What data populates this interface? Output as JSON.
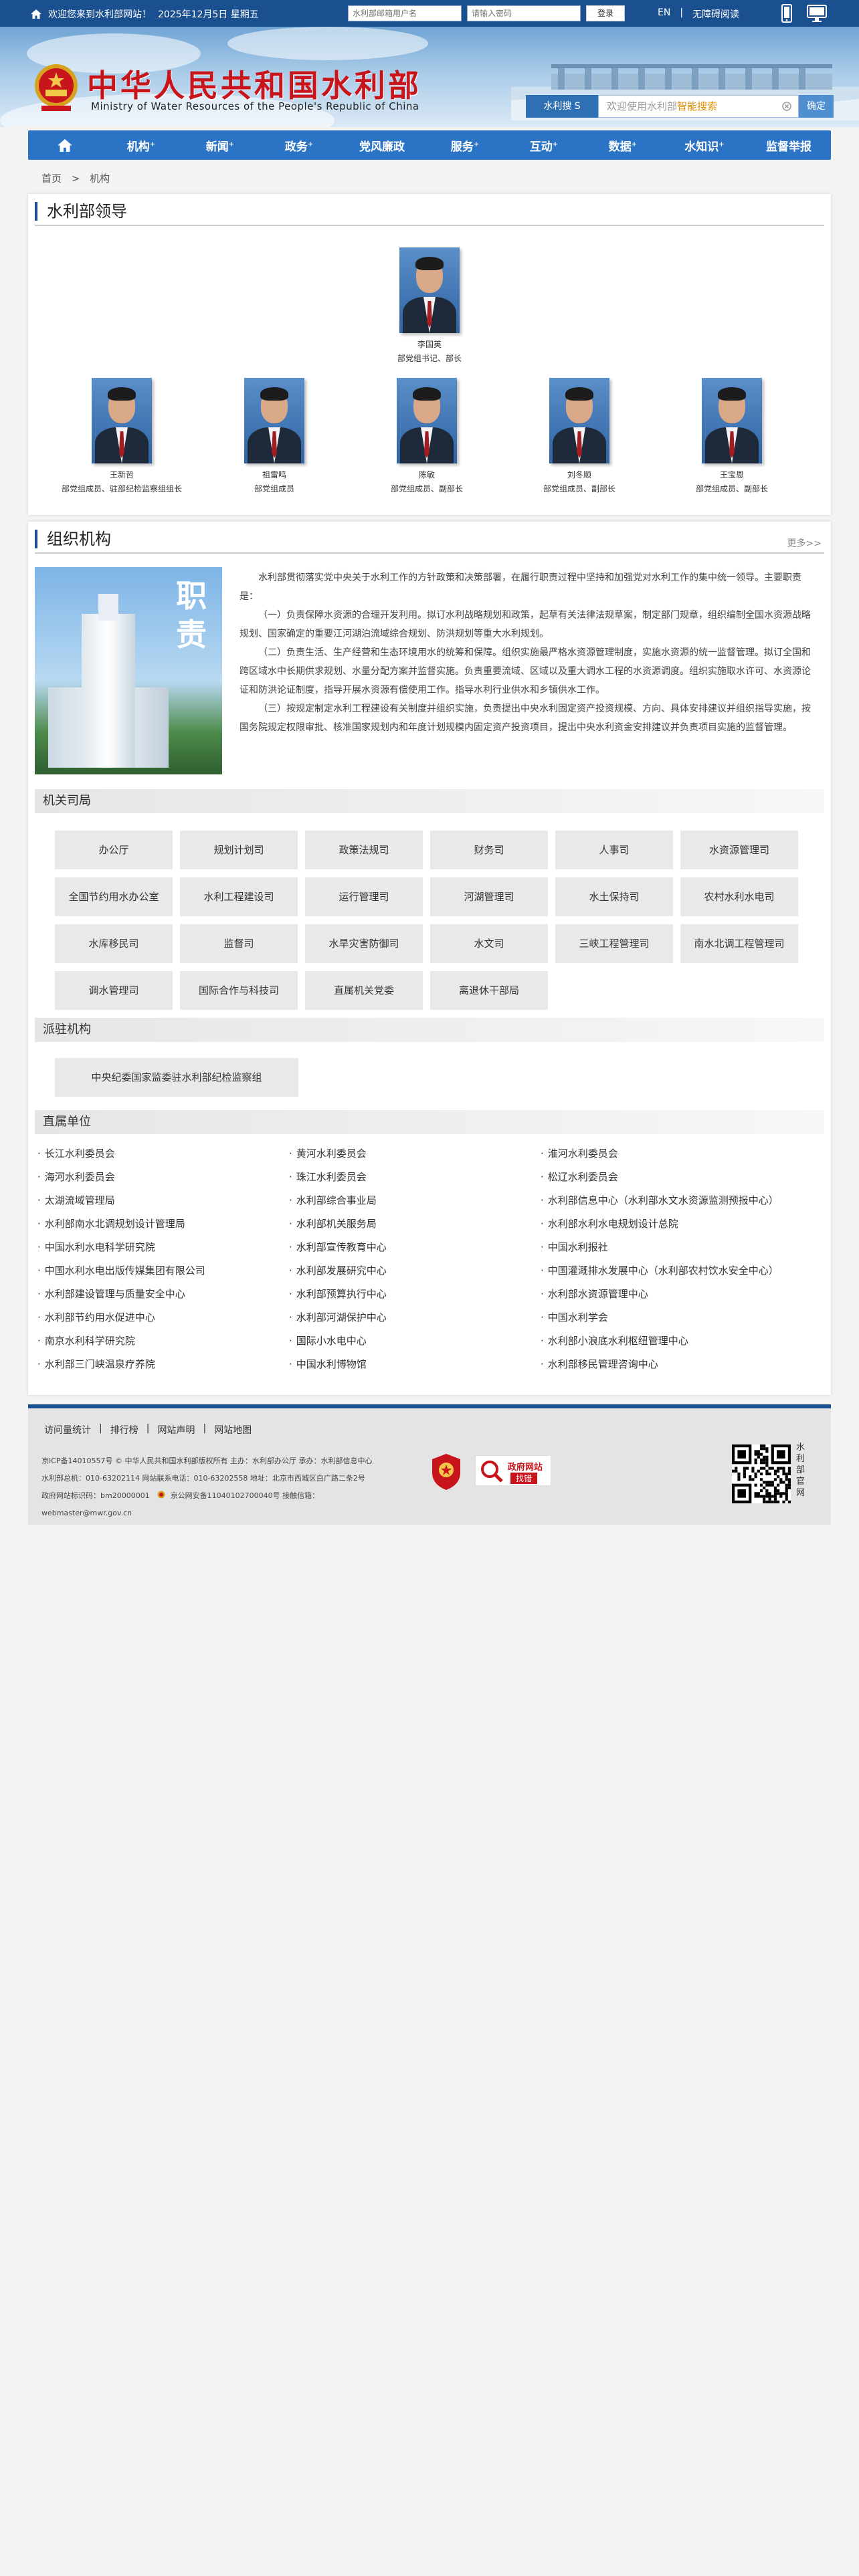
{
  "topbar": {
    "welcome": "欢迎您来到水利部网站！",
    "date": "2025年12月5日 星期五",
    "username_placeholder": "水利部邮箱用户名",
    "password_placeholder": "请输入密码",
    "login_label": "登录",
    "lang_en": "EN",
    "separator": "|",
    "accessibility": "无障碍阅读"
  },
  "header": {
    "title": "中华人民共和国水利部",
    "subtitle": "Ministry of Water Resources of the People's Republic of China",
    "search_label_prefix": "水利搜",
    "search_label_suffix": "S",
    "search_placeholder": "欢迎使用水利部",
    "search_placeholder_hl": "智能搜索",
    "search_button": "确定"
  },
  "nav": {
    "items": [
      "机构",
      "新闻",
      "政务",
      "党风廉政",
      "服务",
      "互动",
      "数据",
      "水知识",
      "监督举报"
    ],
    "has_dropdown": [
      true,
      true,
      true,
      false,
      true,
      true,
      true,
      true,
      false
    ],
    "dropdown_mark": "+"
  },
  "breadcrumb": {
    "home": "首页",
    "sep": ">",
    "current": "机构"
  },
  "leaders": {
    "title": "水利部领导",
    "top": {
      "name": "李国英",
      "role": "部党组书记、部长"
    },
    "row": [
      {
        "name": "王新哲",
        "role": "部党组成员、驻部纪检监察组组长"
      },
      {
        "name": "祖雷鸣",
        "role": "部党组成员"
      },
      {
        "name": "陈敏",
        "role": "部党组成员、副部长"
      },
      {
        "name": "刘冬顺",
        "role": "部党组成员、副部长"
      },
      {
        "name": "王宝恩",
        "role": "部党组成员、副部长"
      }
    ]
  },
  "org": {
    "title": "组织机构",
    "more": "更多>>",
    "image_text": "职责",
    "paragraphs": [
      "水利部贯彻落实党中央关于水利工作的方针政策和决策部署，在履行职责过程中坚持和加强党对水利工作的集中统一领导。主要职责是：",
      "（一）负责保障水资源的合理开发利用。拟订水利战略规划和政策，起草有关法律法规草案，制定部门规章，组织编制全国水资源战略规划、国家确定的重要江河湖泊流域综合规划、防洪规划等重大水利规划。",
      "（二）负责生活、生产经营和生态环境用水的统筹和保障。组织实施最严格水资源管理制度，实施水资源的统一监督管理。拟订全国和跨区域水中长期供求规划、水量分配方案并监督实施。负责重要流域、区域以及重大调水工程的水资源调度。组织实施取水许可、水资源论证和防洪论证制度，指导开展水资源有偿使用工作。指导水利行业供水和乡镇供水工作。",
      "（三）按规定制定水利工程建设有关制度并组织实施，负责提出中央水利固定资产投资规模、方向、具体安排建议并组织指导实施，按国务院规定权限审批、核准国家规划内和年度计划规模内固定资产投资项目，提出中央水利资金安排建议并负责项目实施的监督管理。"
    ],
    "depts_title": "机关司局",
    "depts": [
      "办公厅",
      "规划计划司",
      "政策法规司",
      "财务司",
      "人事司",
      "水资源管理司",
      "全国节约用水办公室",
      "水利工程建设司",
      "运行管理司",
      "河湖管理司",
      "水土保持司",
      "农村水利水电司",
      "水库移民司",
      "监督司",
      "水旱灾害防御司",
      "水文司",
      "三峡工程管理司",
      "南水北调工程管理司",
      "调水管理司",
      "国际合作与科技司",
      "直属机关党委",
      "离退休干部局"
    ],
    "resident_title": "派驻机构",
    "resident": [
      "中央纪委国家监委驻水利部纪检监察组"
    ],
    "direct_title": "直属单位",
    "direct": [
      "长江水利委员会",
      "黄河水利委员会",
      "淮河水利委员会",
      "海河水利委员会",
      "珠江水利委员会",
      "松辽水利委员会",
      "太湖流域管理局",
      "水利部综合事业局",
      "水利部信息中心（水利部水文水资源监测预报中心）",
      "水利部南水北调规划设计管理局",
      "水利部机关服务局",
      "水利部水利水电规划设计总院",
      "中国水利水电科学研究院",
      "水利部宣传教育中心",
      "中国水利报社",
      "中国水利水电出版传媒集团有限公司",
      "水利部发展研究中心",
      "中国灌溉排水发展中心（水利部农村饮水安全中心）",
      "水利部建设管理与质量安全中心",
      "水利部预算执行中心",
      "水利部水资源管理中心",
      "水利部节约用水促进中心",
      "水利部河湖保护中心",
      "中国水利学会",
      "南京水利科学研究院",
      "国际小水电中心",
      "水利部小浪底水利枢纽管理中心",
      "水利部三门峡温泉疗养院",
      "中国水利博物馆",
      "水利部移民管理咨询中心"
    ]
  },
  "footer": {
    "links": [
      "访问量统计",
      "|",
      "排行榜",
      "|",
      "网站声明",
      "|",
      "网站地图"
    ],
    "line1": "京ICP备14010557号 © 中华人民共和国水利部版权所有  主办：水利部办公厅  承办：水利部信息中心",
    "line2": "水利部总机：010-63202114  网站联系电话：010-63202558  地址：北京市西城区白广路二条2号",
    "line3": "政府网站标识码：bm20000001",
    "line3b": "京公网安备11040102700040号  接触信箱：",
    "line4": "webmaster@mwr.gov.cn",
    "gov_badge_top": "政府网站",
    "gov_badge_bottom": "找错",
    "qr_caption": "水利部官网"
  },
  "colors": {
    "brand_blue": "#1a4f90",
    "nav_blue": "#2b73c4",
    "title_red": "#c8141b"
  }
}
